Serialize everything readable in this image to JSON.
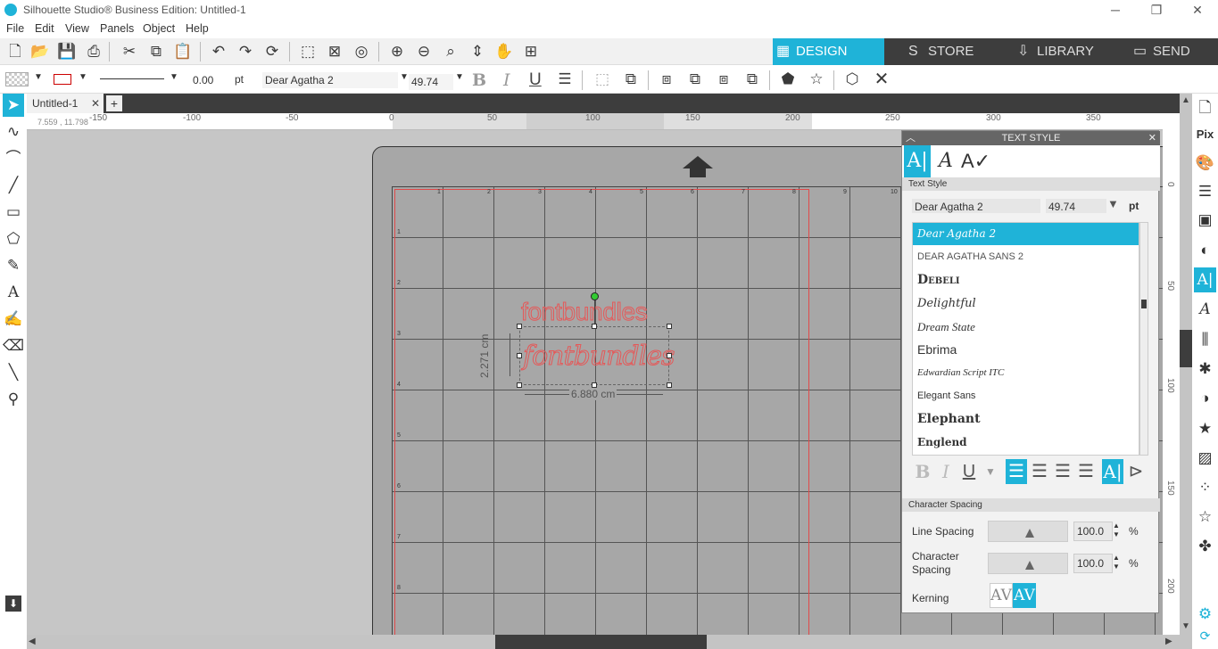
{
  "app": {
    "title": "Silhouette Studio® Business Edition: Untitled-1",
    "minimize": "─",
    "restore": "❐",
    "close": "✕"
  },
  "menu": [
    "File",
    "Edit",
    "View",
    "Panels",
    "Object",
    "Help"
  ],
  "nav_tabs": [
    {
      "label": "DESIGN",
      "icon": "▦"
    },
    {
      "label": "STORE",
      "icon": "S"
    },
    {
      "label": "LIBRARY",
      "icon": "⇩"
    },
    {
      "label": "SEND",
      "icon": "▭"
    }
  ],
  "toolbar": {
    "line_width": "0.00",
    "line_unit": "pt",
    "font": "Dear Agatha 2",
    "font_size": "49.74",
    "bold": "B",
    "italic": "I",
    "underline": "U"
  },
  "document": {
    "tab": "Untitled-1",
    "tab_close": "✕",
    "add_tab": "+",
    "cursor_coords": "7.559 , 11.798"
  },
  "ruler_h": [
    "-150",
    "-100",
    "-50",
    "0",
    "50",
    "100",
    "150",
    "200",
    "250",
    "300",
    "350"
  ],
  "ruler_v": [
    "0",
    "50",
    "100",
    "150",
    "200"
  ],
  "grid_numbers_x": [
    "1",
    "2",
    "3",
    "4",
    "5",
    "6",
    "7",
    "8",
    "9",
    "10"
  ],
  "grid_numbers_y": [
    "1",
    "2",
    "3",
    "4",
    "5",
    "6",
    "7",
    "8"
  ],
  "canvas_text": {
    "line1": "fontbundles",
    "line2": "fontbundles",
    "width": "6.880 cm",
    "height": "2.271 cm"
  },
  "panel": {
    "title": "TEXT STYLE",
    "close": "✕",
    "section_text_style": "Text Style",
    "font_name": "Dear Agatha 2",
    "font_size": "49.74",
    "unit": "pt",
    "fonts": [
      "Dear Agatha 2",
      "DEAR AGATHA SANS 2",
      "Debeli",
      "Delightful",
      "Dream State",
      "Ebrima",
      "Edwardian Script ITC",
      "Elegant Sans",
      "Elephant",
      "Englend"
    ],
    "selected_font": "Dear Agatha 2",
    "section_char_spacing": "Character Spacing",
    "line_spacing_label": "Line Spacing",
    "line_spacing_value": "100.0",
    "char_spacing_label": "Character Spacing",
    "char_spacing_value": "100.0",
    "percent": "%",
    "kerning_label": "Kerning",
    "kern_off": "AV",
    "kern_on": "AV",
    "bold": "B",
    "italic": "I",
    "underline": "U"
  },
  "colors": {
    "accent": "#1fb3d8",
    "dark": "#3d3d3d",
    "text_outline": "#e55858"
  }
}
